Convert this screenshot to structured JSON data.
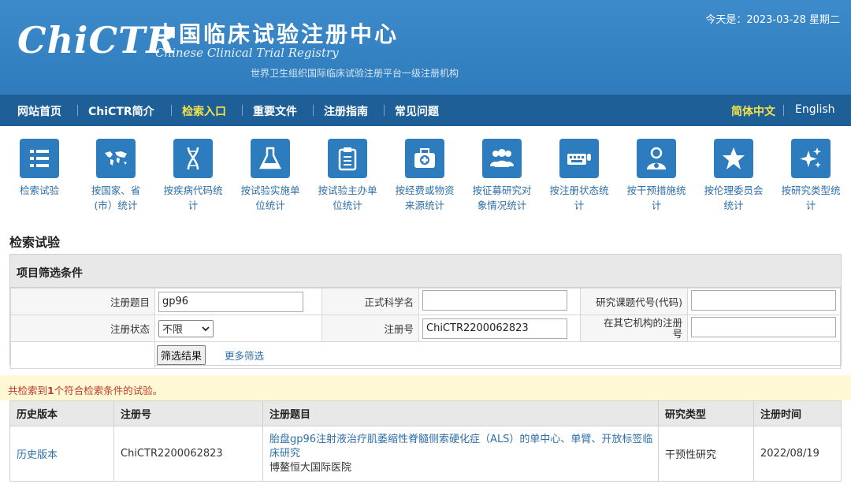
{
  "header": {
    "logo_text": "ChiCTR",
    "title_cn": "中国临床试验注册中心",
    "title_en": "Chinese Clinical Trial Registry",
    "subtitle": "世界卫生组织国际临床试验注册平台一级注册机构",
    "date": "今天是：2023-03-28 星期二"
  },
  "nav": {
    "items": [
      {
        "label": "网站首页",
        "active": false
      },
      {
        "label": "ChiCTR简介",
        "active": false
      },
      {
        "label": "检索入口",
        "active": true
      },
      {
        "label": "重要文件",
        "active": false
      },
      {
        "label": "注册指南",
        "active": false
      },
      {
        "label": "常见问题",
        "active": false
      }
    ],
    "lang_cn": "简体中文",
    "lang_en": "English"
  },
  "icon_menu": [
    {
      "icon": "list-icon",
      "line1": "检索试验",
      "line2": ""
    },
    {
      "icon": "world-map-icon",
      "line1": "按国家、省",
      "line2": "(市）统计"
    },
    {
      "icon": "dna-icon",
      "line1": "按疾病代码统",
      "line2": "计"
    },
    {
      "icon": "flask-icon",
      "line1": "按试验实施单",
      "line2": "位统计"
    },
    {
      "icon": "clipboard-icon",
      "line1": "按试验主办单",
      "line2": "位统计"
    },
    {
      "icon": "medical-kit-icon",
      "line1": "按经费或物资",
      "line2": "来源统计"
    },
    {
      "icon": "people-icon",
      "line1": "按征募研究对",
      "line2": "象情况统计"
    },
    {
      "icon": "keyboard-icon",
      "line1": "按注册状态统",
      "line2": "计"
    },
    {
      "icon": "doctor-icon",
      "line1": "按干预措施统",
      "line2": "计"
    },
    {
      "icon": "star-icon",
      "line1": "按伦理委员会",
      "line2": "统计"
    },
    {
      "icon": "sparkle-icon",
      "line1": "按研究类型统",
      "line2": "计"
    }
  ],
  "page_title": "检索试验",
  "filter": {
    "panel_title": "项目筛选条件",
    "reg_title_label": "注册题目",
    "reg_title_value": "gp96",
    "sci_name_label": "正式科学名",
    "sci_name_value": "",
    "study_code_label": "研究课题代号(代码)",
    "study_code_value": "",
    "reg_status_label": "注册状态",
    "reg_status_value": "不限",
    "reg_no_label": "注册号",
    "reg_no_value": "ChiCTR2200062823",
    "other_reg_label_1": "在其它机构的注册",
    "other_reg_label_2": "号",
    "other_reg_value": "",
    "submit_label": "筛选结果",
    "more_label": "更多筛选"
  },
  "notice": {
    "prefix": "共检索到",
    "count": "1",
    "suffix": "个符合检索条件的试验。"
  },
  "results": {
    "headers": [
      "历史版本",
      "注册号",
      "注册题目",
      "研究类型",
      "注册时间"
    ],
    "rows": [
      {
        "history": "历史版本",
        "reg_no": "ChiCTR2200062823",
        "title": "胎盘gp96注射液治疗肌萎缩性脊髓侧索硬化症（ALS）的单中心、单臂、开放标签临床研究",
        "sponsor": "博鳌恒大国际医院",
        "type": "干预性研究",
        "date": "2022/08/19"
      }
    ]
  },
  "colors": {
    "header_blue": "#3582c2",
    "nav_blue": "#1f5f98",
    "active_yellow": "#f4e24a",
    "link_blue": "#2d6fa8",
    "notice_red": "#c0392b"
  }
}
